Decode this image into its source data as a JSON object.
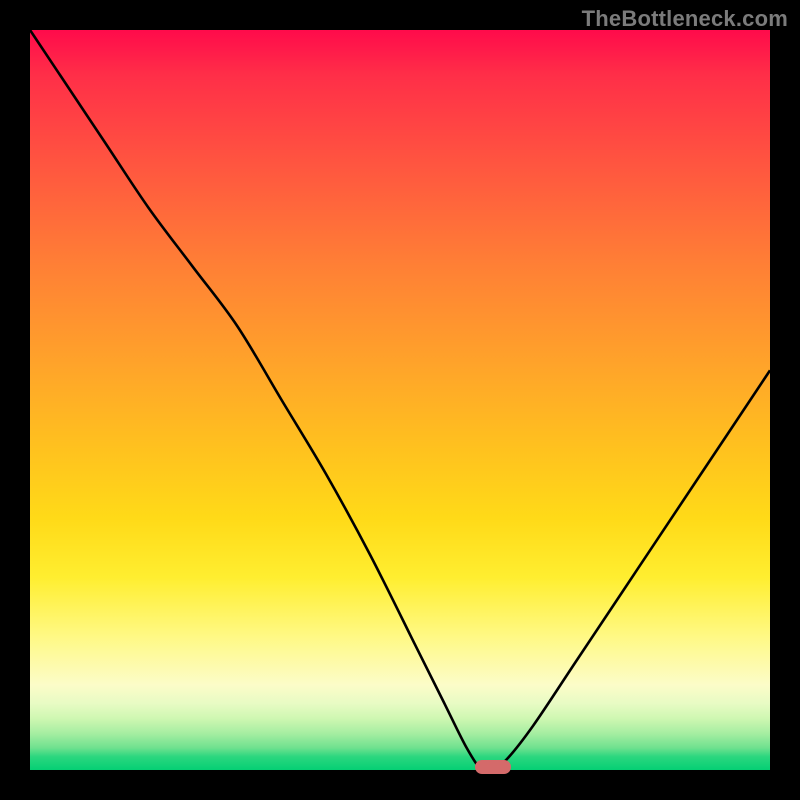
{
  "watermark": "TheBottleneck.com",
  "colors": {
    "page_bg": "#000000",
    "curve_stroke": "#000000",
    "marker_fill": "#d46a6a",
    "gradient_top": "#ff0b4b",
    "gradient_bottom": "#05cf74"
  },
  "chart_data": {
    "type": "line",
    "title": "",
    "xlabel": "",
    "ylabel": "",
    "xlim": [
      0,
      100
    ],
    "ylim": [
      0,
      100
    ],
    "grid": false,
    "legend": false,
    "series": [
      {
        "name": "bottleneck-curve",
        "description": "V-shaped bottleneck curve. y represents bottleneck % (0 = optimal, 100 = worst). Minimum near x≈62.",
        "x": [
          0,
          4,
          10,
          16,
          22,
          28,
          34,
          40,
          46,
          52,
          56,
          59,
          61,
          62,
          64,
          68,
          74,
          82,
          90,
          100
        ],
        "y": [
          100,
          94,
          85,
          76,
          68,
          60,
          50,
          40,
          29,
          17,
          9,
          3,
          0,
          0,
          1,
          6,
          15,
          27,
          39,
          54
        ]
      }
    ],
    "marker": {
      "name": "optimal-point",
      "x_fraction": 0.625,
      "y_value": 0,
      "shape": "pill",
      "color": "#d46a6a"
    },
    "background_gradient": {
      "orientation": "vertical",
      "meaning": "red (high bottleneck) at top → green (no bottleneck) at bottom",
      "stops": [
        {
          "pos": 0.0,
          "color": "#ff0b4b"
        },
        {
          "pos": 0.32,
          "color": "#ff8035"
        },
        {
          "pos": 0.66,
          "color": "#ffda18"
        },
        {
          "pos": 0.88,
          "color": "#fcfcc8"
        },
        {
          "pos": 1.0,
          "color": "#05cf74"
        }
      ]
    }
  }
}
